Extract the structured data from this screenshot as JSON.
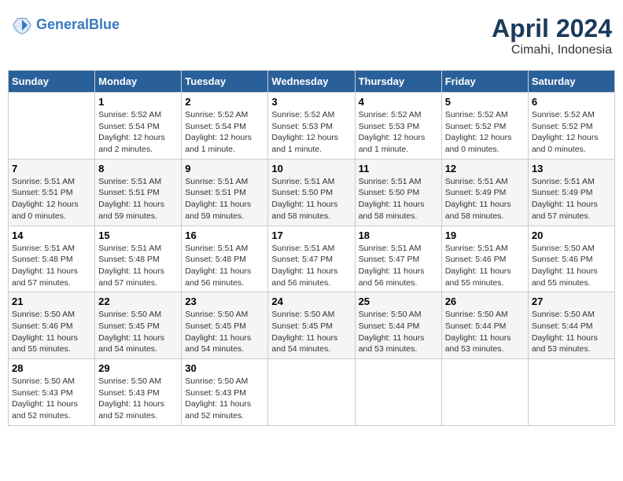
{
  "header": {
    "logo_line1": "General",
    "logo_line2": "Blue",
    "month": "April 2024",
    "location": "Cimahi, Indonesia"
  },
  "weekdays": [
    "Sunday",
    "Monday",
    "Tuesday",
    "Wednesday",
    "Thursday",
    "Friday",
    "Saturday"
  ],
  "weeks": [
    [
      {
        "day": "",
        "info": ""
      },
      {
        "day": "1",
        "info": "Sunrise: 5:52 AM\nSunset: 5:54 PM\nDaylight: 12 hours\nand 2 minutes."
      },
      {
        "day": "2",
        "info": "Sunrise: 5:52 AM\nSunset: 5:54 PM\nDaylight: 12 hours\nand 1 minute."
      },
      {
        "day": "3",
        "info": "Sunrise: 5:52 AM\nSunset: 5:53 PM\nDaylight: 12 hours\nand 1 minute."
      },
      {
        "day": "4",
        "info": "Sunrise: 5:52 AM\nSunset: 5:53 PM\nDaylight: 12 hours\nand 1 minute."
      },
      {
        "day": "5",
        "info": "Sunrise: 5:52 AM\nSunset: 5:52 PM\nDaylight: 12 hours\nand 0 minutes."
      },
      {
        "day": "6",
        "info": "Sunrise: 5:52 AM\nSunset: 5:52 PM\nDaylight: 12 hours\nand 0 minutes."
      }
    ],
    [
      {
        "day": "7",
        "info": "Sunrise: 5:51 AM\nSunset: 5:51 PM\nDaylight: 12 hours\nand 0 minutes."
      },
      {
        "day": "8",
        "info": "Sunrise: 5:51 AM\nSunset: 5:51 PM\nDaylight: 11 hours\nand 59 minutes."
      },
      {
        "day": "9",
        "info": "Sunrise: 5:51 AM\nSunset: 5:51 PM\nDaylight: 11 hours\nand 59 minutes."
      },
      {
        "day": "10",
        "info": "Sunrise: 5:51 AM\nSunset: 5:50 PM\nDaylight: 11 hours\nand 58 minutes."
      },
      {
        "day": "11",
        "info": "Sunrise: 5:51 AM\nSunset: 5:50 PM\nDaylight: 11 hours\nand 58 minutes."
      },
      {
        "day": "12",
        "info": "Sunrise: 5:51 AM\nSunset: 5:49 PM\nDaylight: 11 hours\nand 58 minutes."
      },
      {
        "day": "13",
        "info": "Sunrise: 5:51 AM\nSunset: 5:49 PM\nDaylight: 11 hours\nand 57 minutes."
      }
    ],
    [
      {
        "day": "14",
        "info": "Sunrise: 5:51 AM\nSunset: 5:48 PM\nDaylight: 11 hours\nand 57 minutes."
      },
      {
        "day": "15",
        "info": "Sunrise: 5:51 AM\nSunset: 5:48 PM\nDaylight: 11 hours\nand 57 minutes."
      },
      {
        "day": "16",
        "info": "Sunrise: 5:51 AM\nSunset: 5:48 PM\nDaylight: 11 hours\nand 56 minutes."
      },
      {
        "day": "17",
        "info": "Sunrise: 5:51 AM\nSunset: 5:47 PM\nDaylight: 11 hours\nand 56 minutes."
      },
      {
        "day": "18",
        "info": "Sunrise: 5:51 AM\nSunset: 5:47 PM\nDaylight: 11 hours\nand 56 minutes."
      },
      {
        "day": "19",
        "info": "Sunrise: 5:51 AM\nSunset: 5:46 PM\nDaylight: 11 hours\nand 55 minutes."
      },
      {
        "day": "20",
        "info": "Sunrise: 5:50 AM\nSunset: 5:46 PM\nDaylight: 11 hours\nand 55 minutes."
      }
    ],
    [
      {
        "day": "21",
        "info": "Sunrise: 5:50 AM\nSunset: 5:46 PM\nDaylight: 11 hours\nand 55 minutes."
      },
      {
        "day": "22",
        "info": "Sunrise: 5:50 AM\nSunset: 5:45 PM\nDaylight: 11 hours\nand 54 minutes."
      },
      {
        "day": "23",
        "info": "Sunrise: 5:50 AM\nSunset: 5:45 PM\nDaylight: 11 hours\nand 54 minutes."
      },
      {
        "day": "24",
        "info": "Sunrise: 5:50 AM\nSunset: 5:45 PM\nDaylight: 11 hours\nand 54 minutes."
      },
      {
        "day": "25",
        "info": "Sunrise: 5:50 AM\nSunset: 5:44 PM\nDaylight: 11 hours\nand 53 minutes."
      },
      {
        "day": "26",
        "info": "Sunrise: 5:50 AM\nSunset: 5:44 PM\nDaylight: 11 hours\nand 53 minutes."
      },
      {
        "day": "27",
        "info": "Sunrise: 5:50 AM\nSunset: 5:44 PM\nDaylight: 11 hours\nand 53 minutes."
      }
    ],
    [
      {
        "day": "28",
        "info": "Sunrise: 5:50 AM\nSunset: 5:43 PM\nDaylight: 11 hours\nand 52 minutes."
      },
      {
        "day": "29",
        "info": "Sunrise: 5:50 AM\nSunset: 5:43 PM\nDaylight: 11 hours\nand 52 minutes."
      },
      {
        "day": "30",
        "info": "Sunrise: 5:50 AM\nSunset: 5:43 PM\nDaylight: 11 hours\nand 52 minutes."
      },
      {
        "day": "",
        "info": ""
      },
      {
        "day": "",
        "info": ""
      },
      {
        "day": "",
        "info": ""
      },
      {
        "day": "",
        "info": ""
      }
    ]
  ]
}
